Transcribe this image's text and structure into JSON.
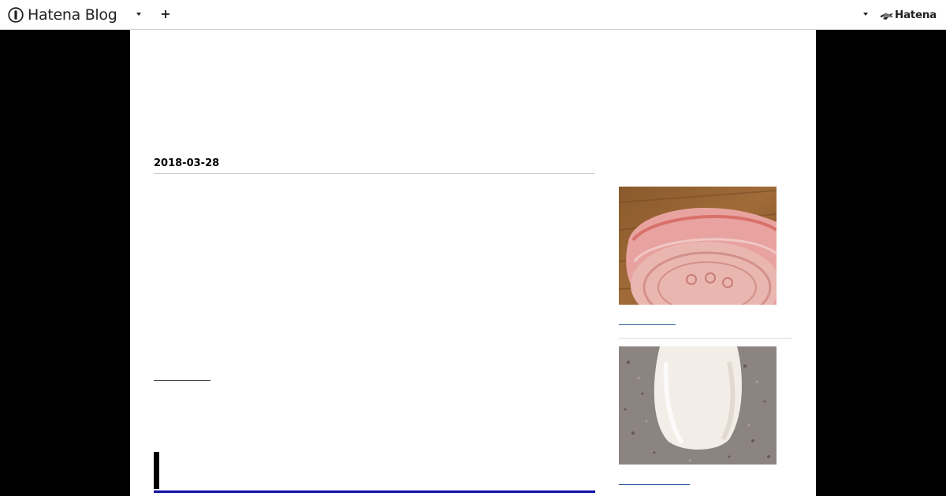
{
  "header": {
    "brand": "Hatena Blog",
    "brand_icon": "hatena-blog-logo-icon",
    "add_icon": "+",
    "company": "Hatena"
  },
  "entry": {
    "date": "2018-03-28"
  },
  "colors": {
    "page_background": "#000000",
    "content_background": "#ffffff",
    "heading_rule": "#0f0fa3",
    "link_underline": "#2f5a9a"
  }
}
